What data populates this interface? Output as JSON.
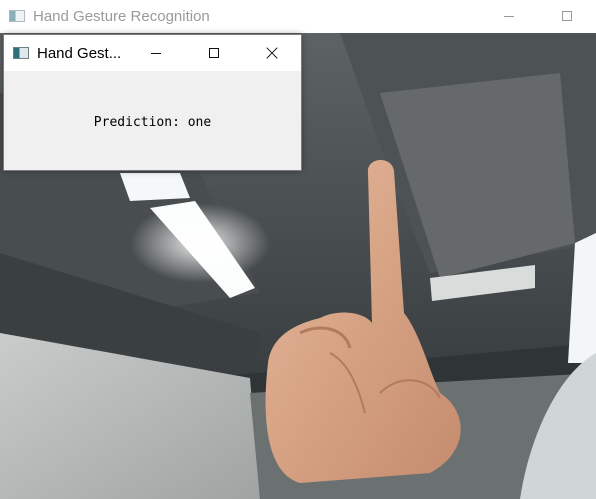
{
  "main_window": {
    "title": "Hand Gesture Recognition",
    "icon": "app-window-icon"
  },
  "popup": {
    "title": "Hand Gest...",
    "icon": "app-window-icon",
    "prediction_text": "Prediction: one"
  },
  "colors": {
    "inactive_title": "#9a9a9a",
    "popup_background": "#f0f0f0",
    "titlebar_background": "#ffffff"
  }
}
